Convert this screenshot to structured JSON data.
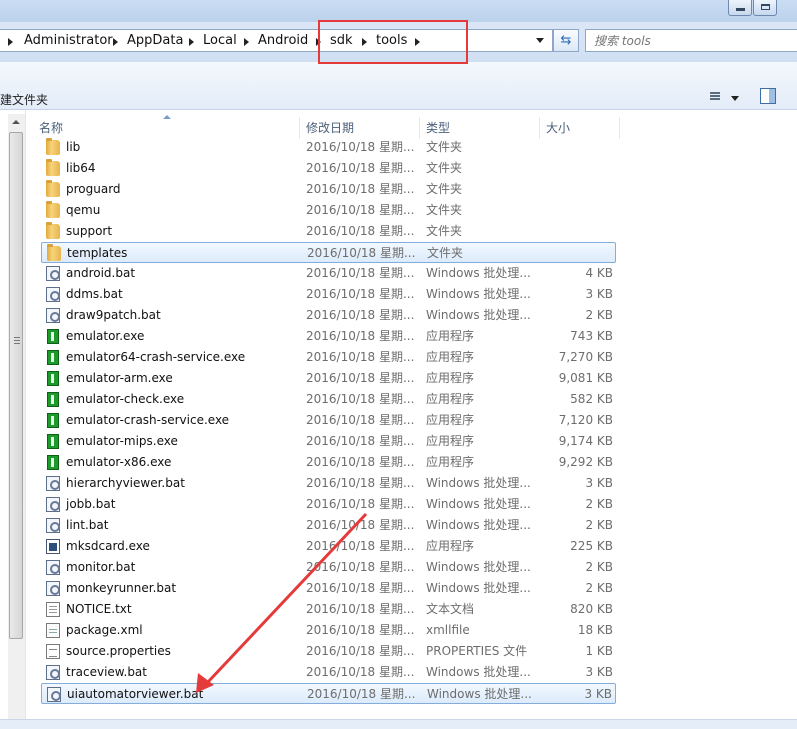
{
  "titlebar": {
    "buttons": [
      "minimize",
      "maximize"
    ]
  },
  "address": {
    "crumbs": [
      "Administrator",
      "AppData",
      "Local",
      "Android",
      "sdk",
      "tools"
    ]
  },
  "search": {
    "placeholder": "搜索 tools"
  },
  "toolbar": {
    "new_folder_label": "建文件夹",
    "view_icon": "details-view-icon",
    "pane_icon": "preview-pane-icon"
  },
  "columns": {
    "name": "名称",
    "date": "修改日期",
    "type": "类型",
    "size": "大小"
  },
  "files": [
    {
      "name": "lib",
      "date": "2016/10/18 星期...",
      "type": "文件夹",
      "size": "",
      "icon": "folder"
    },
    {
      "name": "lib64",
      "date": "2016/10/18 星期...",
      "type": "文件夹",
      "size": "",
      "icon": "folder"
    },
    {
      "name": "proguard",
      "date": "2016/10/18 星期...",
      "type": "文件夹",
      "size": "",
      "icon": "folder"
    },
    {
      "name": "qemu",
      "date": "2016/10/18 星期...",
      "type": "文件夹",
      "size": "",
      "icon": "folder"
    },
    {
      "name": "support",
      "date": "2016/10/18 星期...",
      "type": "文件夹",
      "size": "",
      "icon": "folder"
    },
    {
      "name": "templates",
      "date": "2016/10/18 星期...",
      "type": "文件夹",
      "size": "",
      "icon": "folder"
    },
    {
      "name": "android.bat",
      "date": "2016/10/18 星期...",
      "type": "Windows 批处理...",
      "size": "4 KB",
      "icon": "bat"
    },
    {
      "name": "ddms.bat",
      "date": "2016/10/18 星期...",
      "type": "Windows 批处理...",
      "size": "3 KB",
      "icon": "bat"
    },
    {
      "name": "draw9patch.bat",
      "date": "2016/10/18 星期...",
      "type": "Windows 批处理...",
      "size": "2 KB",
      "icon": "bat"
    },
    {
      "name": "emulator.exe",
      "date": "2016/10/18 星期...",
      "type": "应用程序",
      "size": "743 KB",
      "icon": "exe"
    },
    {
      "name": "emulator64-crash-service.exe",
      "date": "2016/10/18 星期...",
      "type": "应用程序",
      "size": "7,270 KB",
      "icon": "exe"
    },
    {
      "name": "emulator-arm.exe",
      "date": "2016/10/18 星期...",
      "type": "应用程序",
      "size": "9,081 KB",
      "icon": "exe"
    },
    {
      "name": "emulator-check.exe",
      "date": "2016/10/18 星期...",
      "type": "应用程序",
      "size": "582 KB",
      "icon": "exe"
    },
    {
      "name": "emulator-crash-service.exe",
      "date": "2016/10/18 星期...",
      "type": "应用程序",
      "size": "7,120 KB",
      "icon": "exe"
    },
    {
      "name": "emulator-mips.exe",
      "date": "2016/10/18 星期...",
      "type": "应用程序",
      "size": "9,174 KB",
      "icon": "exe"
    },
    {
      "name": "emulator-x86.exe",
      "date": "2016/10/18 星期...",
      "type": "应用程序",
      "size": "9,292 KB",
      "icon": "exe"
    },
    {
      "name": "hierarchyviewer.bat",
      "date": "2016/10/18 星期...",
      "type": "Windows 批处理...",
      "size": "3 KB",
      "icon": "bat"
    },
    {
      "name": "jobb.bat",
      "date": "2016/10/18 星期...",
      "type": "Windows 批处理...",
      "size": "2 KB",
      "icon": "bat"
    },
    {
      "name": "lint.bat",
      "date": "2016/10/18 星期...",
      "type": "Windows 批处理...",
      "size": "2 KB",
      "icon": "bat"
    },
    {
      "name": "mksdcard.exe",
      "date": "2016/10/18 星期...",
      "type": "应用程序",
      "size": "225 KB",
      "icon": "exe2"
    },
    {
      "name": "monitor.bat",
      "date": "2016/10/18 星期...",
      "type": "Windows 批处理...",
      "size": "2 KB",
      "icon": "bat"
    },
    {
      "name": "monkeyrunner.bat",
      "date": "2016/10/18 星期...",
      "type": "Windows 批处理...",
      "size": "2 KB",
      "icon": "bat"
    },
    {
      "name": "NOTICE.txt",
      "date": "2016/10/18 星期...",
      "type": "文本文档",
      "size": "820 KB",
      "icon": "txt"
    },
    {
      "name": "package.xml",
      "date": "2016/10/18 星期...",
      "type": "xmllfile",
      "size": "18 KB",
      "icon": "xml"
    },
    {
      "name": "source.properties",
      "date": "2016/10/18 星期...",
      "type": "PROPERTIES 文件",
      "size": "1 KB",
      "icon": "props"
    },
    {
      "name": "traceview.bat",
      "date": "2016/10/18 星期...",
      "type": "Windows 批处理...",
      "size": "3 KB",
      "icon": "bat"
    },
    {
      "name": "uiautomatorviewer.bat",
      "date": "2016/10/18 星期...",
      "type": "Windows 批处理...",
      "size": "3 KB",
      "icon": "bat"
    }
  ],
  "highlighted_rows": [
    "templates",
    "uiautomatorviewer.bat"
  ],
  "annotation": {
    "box_color": "#e53a3a",
    "arrow_color": "#e53a3a"
  }
}
